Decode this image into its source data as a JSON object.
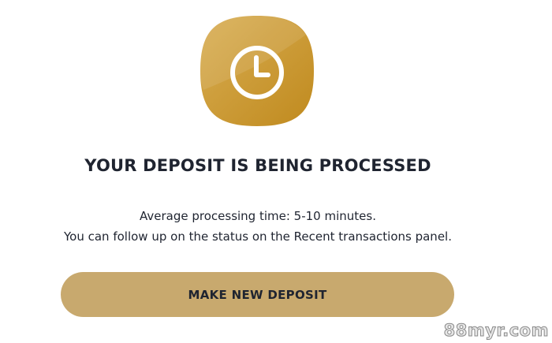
{
  "status": {
    "icon": "clock-icon",
    "icon_color": "#c99a2e",
    "title": "YOUR DEPOSIT IS BEING PROCESSED",
    "line1": "Average processing time: 5-10 minutes.",
    "line2": "You can follow up on the status on the Recent transactions panel."
  },
  "actions": {
    "make_new_deposit_label": "MAKE NEW DEPOSIT",
    "button_color": "#c8a96e"
  },
  "watermark": {
    "text": "88myr.com"
  }
}
